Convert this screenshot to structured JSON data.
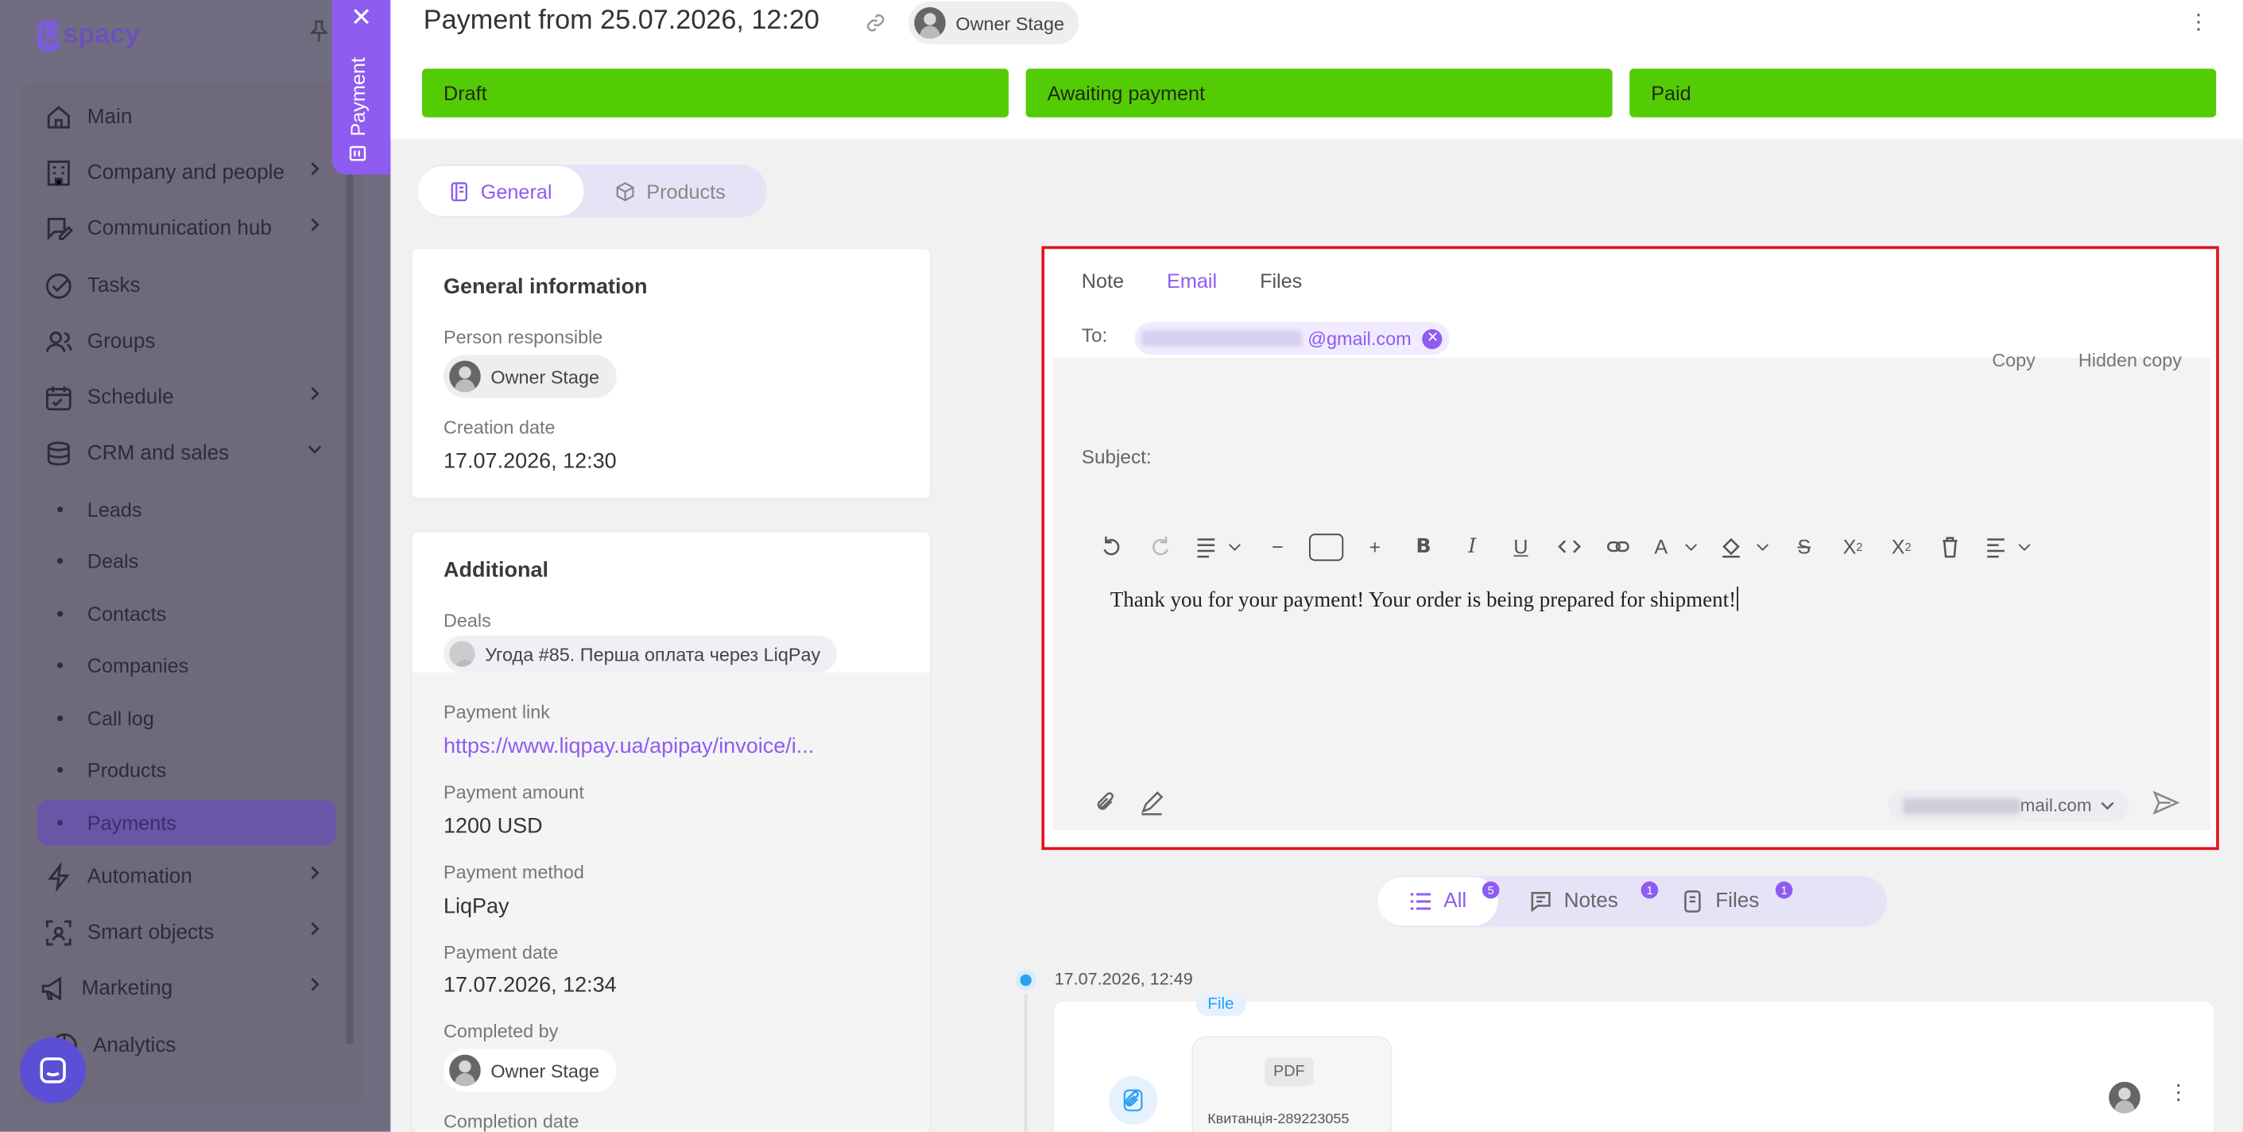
{
  "sidebar": {
    "logo": "spacy",
    "items": [
      {
        "label": "Main",
        "icon": "home-icon"
      },
      {
        "label": "Company and people",
        "icon": "building-icon"
      },
      {
        "label": "Communication hub",
        "icon": "chat-edit-icon"
      },
      {
        "label": "Tasks",
        "icon": "check-circle-icon"
      },
      {
        "label": "Groups",
        "icon": "users-icon"
      },
      {
        "label": "Schedule",
        "icon": "calendar-icon"
      },
      {
        "label": "CRM and sales",
        "icon": "database-icon"
      },
      {
        "label": "Automation",
        "icon": "lightning-icon"
      },
      {
        "label": "Smart objects",
        "icon": "smart-object-icon"
      },
      {
        "label": "Marketing",
        "icon": "megaphone-icon"
      },
      {
        "label": "Analytics",
        "icon": "chart-icon"
      }
    ],
    "crm_sub": [
      "Leads",
      "Deals",
      "Contacts",
      "Companies",
      "Call log",
      "Products",
      "Payments"
    ],
    "active_sub": "Payments"
  },
  "side_tab": {
    "label": "Payment"
  },
  "header": {
    "title": "Payment from 25.07.2026, 12:20",
    "owner": "Owner Stage",
    "stages": [
      "Draft",
      "Awaiting payment",
      "Paid"
    ],
    "stage_color": "#54cc05"
  },
  "tabs": {
    "general": "General",
    "products": "Products"
  },
  "general_info": {
    "heading": "General information",
    "responsible_label": "Person responsible",
    "responsible": "Owner Stage",
    "creation_label": "Creation date",
    "creation": "17.07.2026, 12:30"
  },
  "additional": {
    "heading": "Additional",
    "deals_label": "Deals",
    "deal": "Угода #85. Перша оплата через LiqPay",
    "link_label": "Payment link",
    "link": "https://www.liqpay.ua/apipay/invoice/i...",
    "amount_label": "Payment amount",
    "amount": "1200 USD",
    "method_label": "Payment method",
    "method": "LiqPay",
    "date_label": "Payment date",
    "date": "17.07.2026, 12:34",
    "completed_label": "Completed by",
    "completed": "Owner Stage",
    "completion_label": "Completion date"
  },
  "composer": {
    "tabs": [
      "Note",
      "Email",
      "Files"
    ],
    "active_tab": "Email",
    "to_label": "To:",
    "to_suffix": "@gmail.com",
    "copy": "Copy",
    "hidden_copy": "Hidden copy",
    "subject_label": "Subject:",
    "body": "Thank you for your payment! Your order is being prepared for shipment!",
    "from_suffix": "mail.com",
    "accent": "#8e5cf0",
    "highlight_border": "#e0111c"
  },
  "filters": {
    "all": "All",
    "all_count": "5",
    "notes": "Notes",
    "notes_count": "1",
    "files": "Files",
    "files_count": "1"
  },
  "timeline": {
    "date": "17.07.2026, 12:49",
    "tag": "File",
    "pdf": "PDF",
    "file_name": "Квитанція-289223055"
  }
}
